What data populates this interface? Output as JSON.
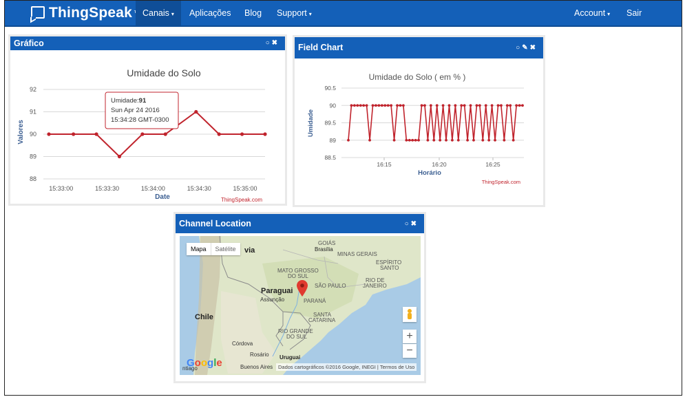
{
  "navbar": {
    "brand": "ThingSpeak",
    "trademark": "™",
    "items": [
      "Canais",
      "Aplicações",
      "Blog",
      "Support"
    ],
    "account": "Account",
    "logout": "Sair"
  },
  "panel_grafico": {
    "title": "Gráfico",
    "icons": " ○ ✖",
    "watermark": "ThingSpeak.com",
    "tooltip": {
      "label": "Umidade:",
      "value": "91",
      "date": "Sun Apr 24 2016",
      "time": "15:34:28 GMT-0300"
    }
  },
  "panel_field": {
    "title": "Field Chart",
    "icons": "○ ✎ ✖",
    "watermark": "ThingSpeak.com"
  },
  "panel_location": {
    "title": "Channel Location",
    "icons": "○ ✖",
    "map_type_map": "Mapa",
    "map_type_satellite": "Satélite",
    "zoom_in": "+",
    "zoom_out": "−",
    "google": "Google",
    "attribution": "Dados cartográficos ©2016 Google, INEGI   |   Termos de Uso",
    "labels": {
      "goias": "GOIÁS",
      "brasilia": "Brasília",
      "minas": "MINAS GERAIS",
      "espirito": "ESPÍRITO",
      "santo": "SANTO",
      "rio": "RIO DE",
      "janeiro": "JANEIRO",
      "mato": "MATO GROSSO",
      "dosul": "DO SUL",
      "sp": "SÃO PAULO",
      "paraguai": "Paraguai",
      "assuncao": "Assunção",
      "parana": "PARANÁ",
      "chile": "Chile",
      "santa": "SANTA",
      "catarina": "CATARINA",
      "riogrande": "RIO GRANDE",
      "riogrande2": "DO SUL",
      "cordova": "Córdova",
      "rosario": "Rosário",
      "uruguai": "Uruguai",
      "buenos": "Buenos Aires",
      "via": "via",
      "ntiago": "ntiago"
    }
  },
  "colors": {
    "nav": "#1460b8",
    "series": "#c0232c",
    "axis_label": "#3b5e91"
  },
  "chart_data": [
    {
      "type": "line",
      "title": "Umidade do Solo",
      "xlabel": "Date",
      "ylabel": "Valores",
      "x_ticks": [
        "15:33:00",
        "15:33:30",
        "15:34:00",
        "15:34:30",
        "15:35:00"
      ],
      "y_ticks": [
        88,
        89,
        90,
        91,
        92
      ],
      "ylim": [
        88,
        92
      ],
      "grid": true,
      "series": [
        {
          "x": [
            "15:32:52",
            "15:33:08",
            "15:33:23",
            "15:33:38",
            "15:33:53",
            "15:34:08",
            "15:34:28",
            "15:34:43",
            "15:34:58",
            "15:35:13"
          ],
          "values": [
            90,
            90,
            90,
            89,
            90,
            90,
            91,
            90,
            90,
            90
          ]
        }
      ]
    },
    {
      "type": "line",
      "title": "Umidade do Solo ( em % )",
      "xlabel": "Horário",
      "ylabel": "Umidade",
      "x_ticks": [
        "16:15",
        "16:20",
        "16:25"
      ],
      "y_ticks": [
        88.5,
        89,
        89.5,
        90,
        90.5
      ],
      "ylim": [
        88.5,
        90.5
      ],
      "grid": true,
      "series": [
        {
          "values": [
            89,
            90,
            90,
            90,
            90,
            90,
            90,
            89,
            90,
            90,
            90,
            90,
            90,
            90,
            90,
            89,
            90,
            90,
            90,
            89,
            89,
            89,
            89,
            89,
            90,
            90,
            89,
            90,
            89,
            90,
            89,
            90,
            89,
            90,
            89,
            90,
            89,
            90,
            90,
            89,
            90,
            89,
            90,
            90,
            89,
            90,
            89,
            90,
            89,
            90,
            90,
            89,
            90,
            90,
            89,
            90,
            90,
            90
          ]
        }
      ]
    }
  ]
}
